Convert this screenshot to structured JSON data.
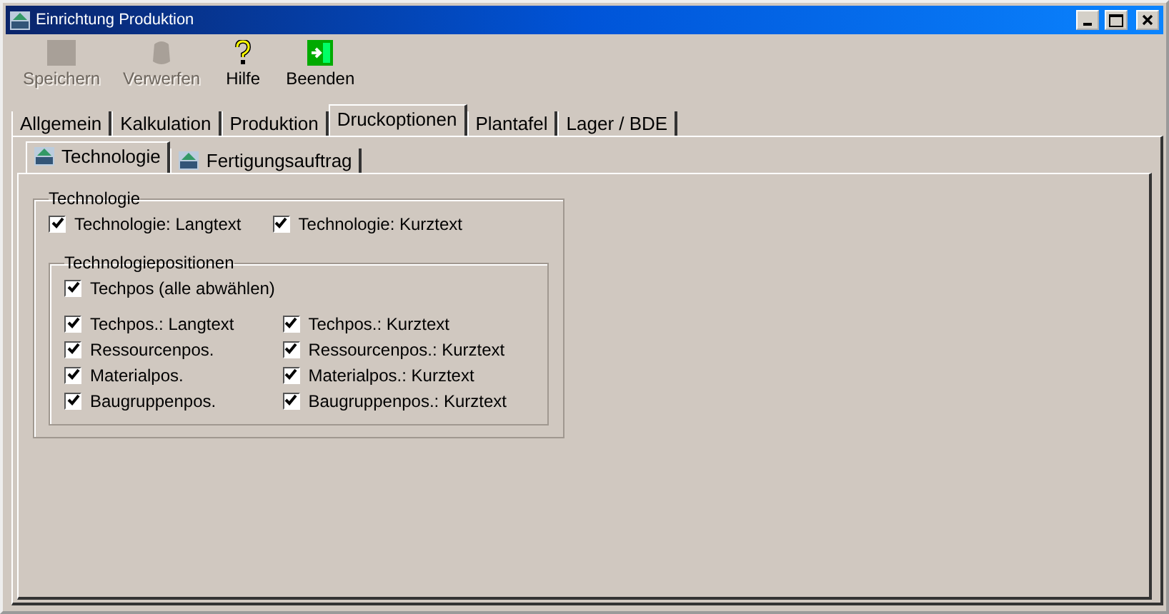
{
  "window": {
    "title": "Einrichtung Produktion"
  },
  "toolbar": [
    {
      "kind": "save",
      "label": "Speichern",
      "disabled": true
    },
    {
      "kind": "discard",
      "label": "Verwerfen",
      "disabled": true
    },
    {
      "kind": "help",
      "label": "Hilfe",
      "disabled": false
    },
    {
      "kind": "exit",
      "label": "Beenden",
      "disabled": false
    }
  ],
  "tabs": [
    {
      "label": "Allgemein",
      "selected": false
    },
    {
      "label": "Kalkulation",
      "selected": false
    },
    {
      "label": "Produktion",
      "selected": false
    },
    {
      "label": "Druckoptionen",
      "selected": true
    },
    {
      "label": "Plantafel",
      "selected": false
    },
    {
      "label": "Lager / BDE",
      "selected": false
    }
  ],
  "subtabs": [
    {
      "label": "Technologie",
      "selected": true
    },
    {
      "label": "Fertigungsauftrag",
      "selected": false
    }
  ],
  "technologie": {
    "title": "Technologie",
    "options": [
      {
        "label": "Technologie: Langtext",
        "checked": true
      },
      {
        "label": "Technologie: Kurztext",
        "checked": true
      }
    ]
  },
  "positionen": {
    "title": "Technologiepositionen",
    "all": {
      "label": "Techpos (alle abwählen)",
      "checked": true
    },
    "left": [
      {
        "label": "Techpos.: Langtext",
        "checked": true
      },
      {
        "label": "Ressourcenpos.",
        "checked": true
      },
      {
        "label": "Materialpos.",
        "checked": true
      },
      {
        "label": "Baugruppenpos.",
        "checked": true
      }
    ],
    "right": [
      {
        "label": "Techpos.: Kurztext",
        "checked": true
      },
      {
        "label": "Ressourcenpos.: Kurztext",
        "checked": true
      },
      {
        "label": "Materialpos.: Kurztext",
        "checked": true
      },
      {
        "label": "Baugruppenpos.: Kurztext",
        "checked": true
      }
    ]
  }
}
